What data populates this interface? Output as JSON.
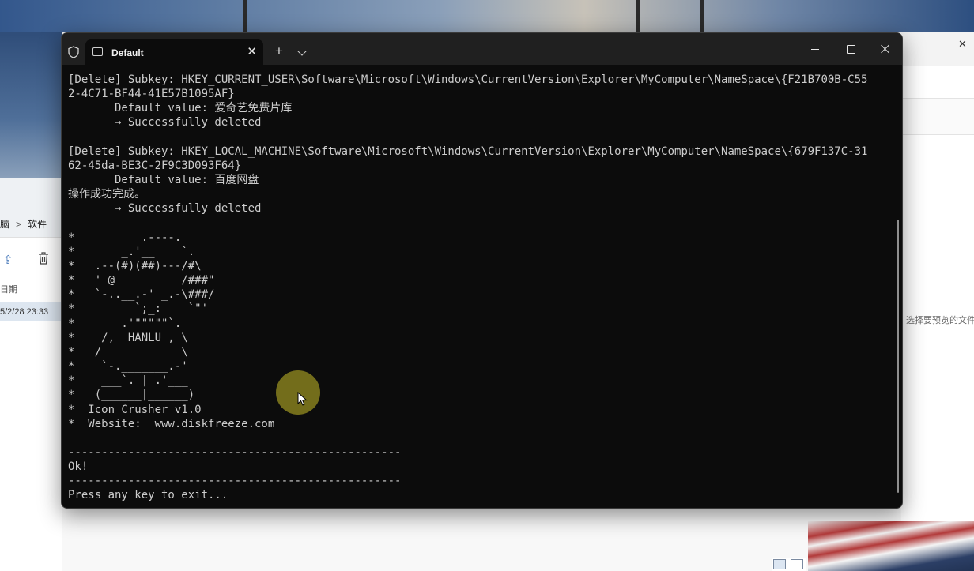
{
  "terminal": {
    "tab_title": "Default",
    "new_tab_label": "+",
    "lines": [
      "[Delete] Subkey: HKEY_CURRENT_USER\\Software\\Microsoft\\Windows\\CurrentVersion\\Explorer\\MyComputer\\NameSpace\\{F21B700B-C55",
      "2-4C71-BF44-41E57B1095AF}",
      "       Default value: 爱奇艺免费片库",
      "       → Successfully deleted",
      "",
      "[Delete] Subkey: HKEY_LOCAL_MACHINE\\Software\\Microsoft\\Windows\\CurrentVersion\\Explorer\\MyComputer\\NameSpace\\{679F137C-31",
      "62-45da-BE3C-2F9C3D093F64}",
      "       Default value: 百度网盘",
      "操作成功完成。",
      "       → Successfully deleted",
      "",
      "*          .----.",
      "*       _.'__    `.",
      "*   .--(#)(##)---/#\\",
      "*   ' @          /###\"",
      "*   `-..__.-' _.-\\###/",
      "*         `;_:    `\"'",
      "*       .'\"\"\"\"\"`.",
      "*    /,  HANLU , \\",
      "*   /            \\",
      "*    `-._______.-'",
      "*    ___`. | .'___",
      "*   (______|______)",
      "*  Icon Crusher v1.0",
      "*  Website:  www.diskfreeze.com",
      "",
      "--------------------------------------------------",
      "Ok!",
      "--------------------------------------------------",
      "Press any key to exit..."
    ]
  },
  "background_explorer": {
    "breadcrumb": [
      "脑",
      "软件"
    ],
    "column_header": "日期",
    "row_date": "5/2/28 23:33",
    "preview_hint": "选择要预览的文件"
  },
  "icons": {
    "shield": "shield-icon",
    "tab": "terminal-tab-icon",
    "close_tab": "close-icon",
    "new_tab": "plus-icon",
    "dropdown": "chevron-down-icon",
    "minimize": "minimize-icon",
    "maximize": "maximize-icon",
    "close_window": "close-icon",
    "share": "share-icon",
    "delete": "trash-icon",
    "cursor": "mouse-cursor-icon"
  },
  "colors": {
    "terminal_bg": "#0c0c0c",
    "titlebar_bg": "#202020",
    "text": "#cccccc",
    "cursor_halo": "#c8be28"
  }
}
